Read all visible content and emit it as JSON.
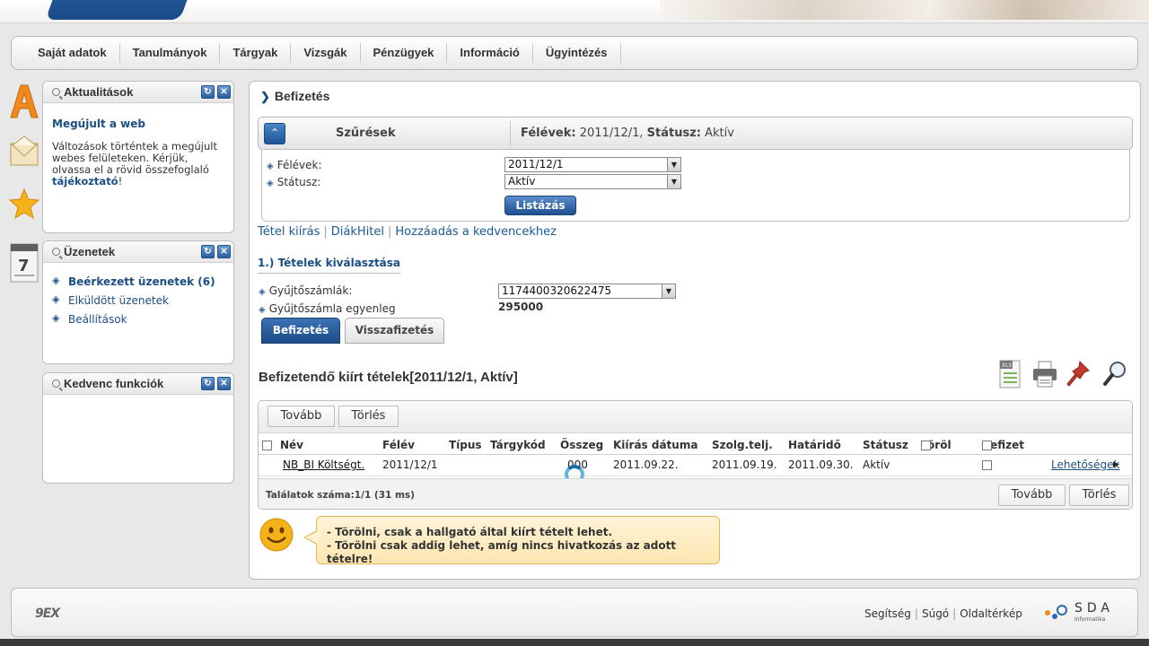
{
  "nav": {
    "items": [
      "Saját adatok",
      "Tanulmányok",
      "Tárgyak",
      "Vizsgák",
      "Pénzügyek",
      "Információ",
      "Ügyintézés"
    ]
  },
  "widgets": {
    "news": {
      "title": "Aktualitások",
      "headline": "Megújult a web",
      "text": "Változások történtek a megújult webes felületeken. Kérjük, olvassa el a rövid összefoglaló",
      "link": "tájékoztató",
      "suffix": "!"
    },
    "messages": {
      "title": "Üzenetek",
      "items": [
        "Beérkezett üzenetek (6)",
        "Elküldött üzenetek",
        "Beállítások"
      ]
    },
    "favorites": {
      "title": "Kedvenc funkciók"
    }
  },
  "main": {
    "breadcrumb": "Befizetés",
    "filter": {
      "label": "Szűrések",
      "summary_semester_label": "Félévek:",
      "summary_semester_value": "2011/12/1",
      "summary_status_label": "Státusz:",
      "summary_status_value": "Aktív",
      "semester_label": "Félévek:",
      "semester_value": "2011/12/1",
      "status_label": "Státusz:",
      "status_value": "Aktív",
      "list_button": "Listázás"
    },
    "links": [
      "Tétel kiírás",
      "DiákHitel",
      "Hozzáadás a kedvencekhez"
    ],
    "section_title": "1.) Tételek kiválasztása",
    "account_label": "Gyűjtőszámlák:",
    "account_value": "1174400320622475",
    "balance_label": "Gyűjtőszámla egyenleg",
    "balance_value": "295000",
    "tabs": [
      "Befizetés",
      "Visszafizetés"
    ],
    "list_title": "Befizetendő kiírt tételek[2011/12/1, Aktív]",
    "grid": {
      "top_buttons": [
        "Tovább",
        "Törlés"
      ],
      "columns": [
        "Név",
        "Félév",
        "Típus",
        "Tárgykód",
        "Összeg",
        "Kiírás dátuma",
        "Szolg.telj.",
        "Határidő",
        "Státusz",
        "Töröl",
        "Befizet"
      ],
      "rows": [
        {
          "name": "NB_BI Költségt.",
          "semester": "2011/12/1",
          "type": "",
          "subject_code": "",
          "amount": "000",
          "issue_date": "2011.09.22.",
          "service_date": "2011.09.19.",
          "deadline": "2011.09.30.",
          "status": "Aktív",
          "options": "Lehetőségek"
        }
      ],
      "count": "Találatok száma:1/1 (31 ms)",
      "bottom_buttons": [
        "Tovább",
        "Törlés"
      ]
    },
    "tips": [
      "- Törölni, csak a hallgató által kiírt tételt lehet.",
      "- Törölni csak addig lehet, amíg nincs hivatkozás az adott tételre!"
    ]
  },
  "footer": {
    "logo": "9EX",
    "links": [
      "Segítség",
      "Súgó",
      "Oldaltérkép"
    ],
    "brand": "SDA",
    "brand_sub": "Informatika"
  }
}
